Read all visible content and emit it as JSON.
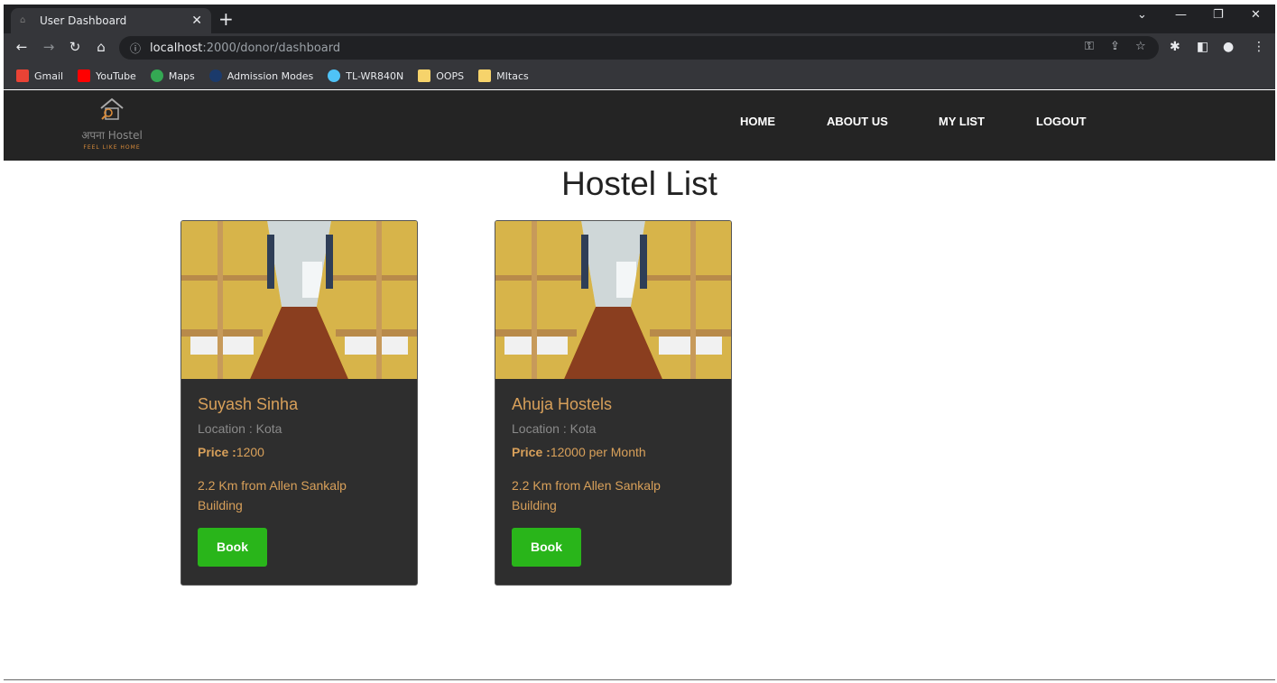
{
  "browser": {
    "tab_title": "User Dashboard",
    "url_host": "localhost",
    "url_path": ":2000/donor/dashboard",
    "bookmarks": [
      {
        "label": "Gmail",
        "color": "#ea4335"
      },
      {
        "label": "YouTube",
        "color": "#ff0000"
      },
      {
        "label": "Maps",
        "color": "#34a853"
      },
      {
        "label": "Admission Modes",
        "color": "#1b3a6b"
      },
      {
        "label": "TL-WR840N",
        "color": "#4fc3f7"
      },
      {
        "label": "OOPS",
        "color": "#f6d36b"
      },
      {
        "label": "MItacs",
        "color": "#f6d36b"
      }
    ]
  },
  "site": {
    "logo_brand": "अपना Hostel",
    "logo_tagline": "FEEL LIKE HOME",
    "nav": {
      "home": "HOME",
      "about": "ABOUT US",
      "mylist": "MY LIST",
      "logout": "LOGOUT"
    }
  },
  "page": {
    "title": "Hostel List",
    "hostels": [
      {
        "name": "Suyash Sinha",
        "location": "Location : Kota",
        "price_label": "Price :",
        "price_value": "1200",
        "distance": "2.2 Km from Allen Sankalp Building",
        "book_label": "Book"
      },
      {
        "name": "Ahuja Hostels",
        "location": "Location : Kota",
        "price_label": "Price :",
        "price_value": "12000 per Month",
        "distance": "2.2 Km from Allen Sankalp Building",
        "book_label": "Book"
      }
    ]
  },
  "colors": {
    "nav_bg": "#242424",
    "card_bg": "#2e2e2e",
    "accent_text": "#d8a05a",
    "book_button": "#29b51a"
  }
}
